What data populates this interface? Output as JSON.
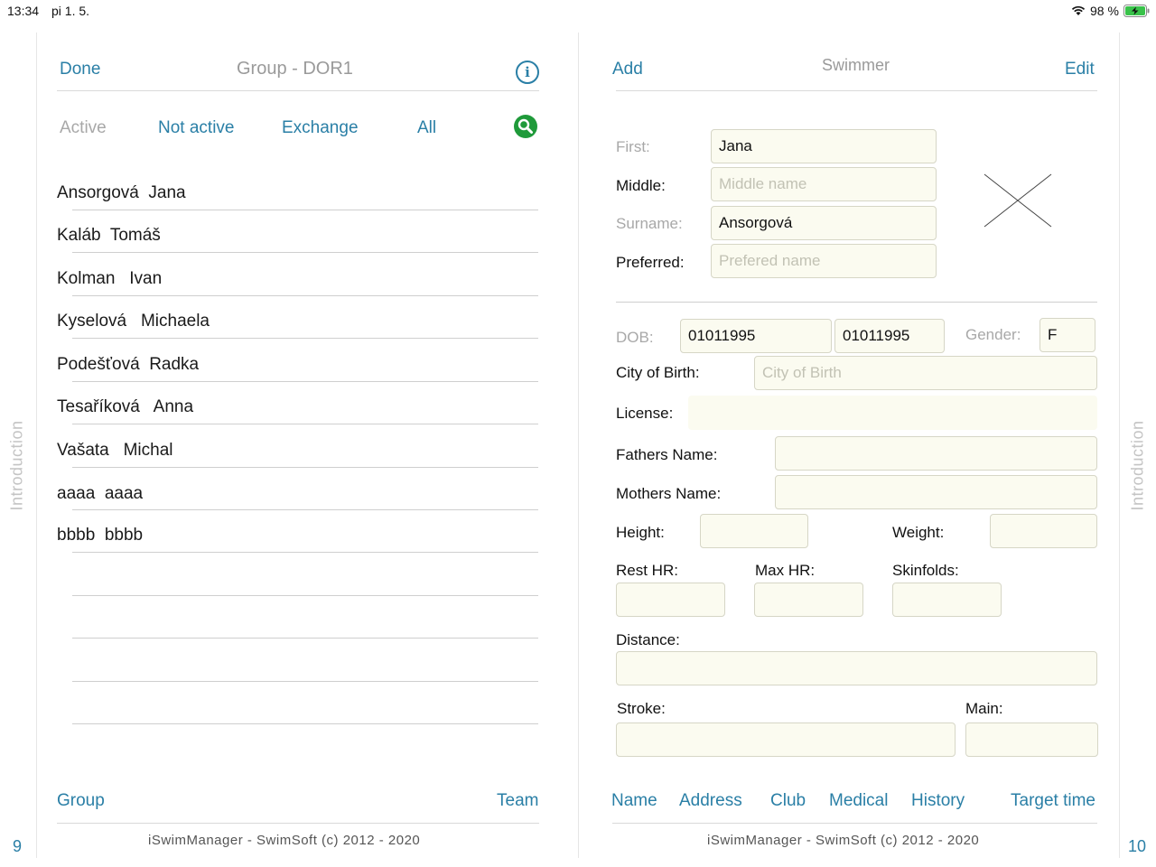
{
  "status_bar": {
    "time": "13:34",
    "date": "pi 1. 5.",
    "battery_percent": "98 %",
    "icons": [
      "wifi-icon",
      "battery-charging-icon"
    ]
  },
  "left_panel": {
    "done": "Done",
    "title": "Group - DOR1",
    "info_icon": "i",
    "tabs": {
      "active": "Active",
      "not_active": "Not active",
      "exchange": "Exchange",
      "all": "All"
    },
    "swimmers": [
      {
        "surname": "Ansorgová",
        "first": "Jana"
      },
      {
        "surname": "Kaláb",
        "first": "Tomáš"
      },
      {
        "surname": "Kolman",
        "first": "Ivan"
      },
      {
        "surname": "Kyselová",
        "first": "Michaela"
      },
      {
        "surname": "Podešťová",
        "first": "Radka"
      },
      {
        "surname": "Tesaříková",
        "first": "Anna"
      },
      {
        "surname": "Vašata",
        "first": "Michal"
      },
      {
        "surname": "aaaa",
        "first": "aaaa"
      },
      {
        "surname": "bbbb",
        "first": "bbbb"
      }
    ],
    "bottom_nav": {
      "group": "Group",
      "team": "Team"
    },
    "footer": "iSwimManager - SwimSoft (c) 2012 - 2020",
    "page_number": "9",
    "side_label": "Introduction"
  },
  "right_panel": {
    "add": "Add",
    "title": "Swimmer",
    "edit": "Edit",
    "labels": {
      "first": "First:",
      "middle": "Middle:",
      "surname": "Surname:",
      "preferred": "Preferred:",
      "dob": "DOB:",
      "gender": "Gender:",
      "city_of_birth": "City of Birth:",
      "license": "License:",
      "fathers_name": "Fathers Name:",
      "mothers_name": "Mothers Name:",
      "height": "Height:",
      "weight": "Weight:",
      "rest_hr": "Rest HR:",
      "max_hr": "Max HR:",
      "skinfolds": "Skinfolds:",
      "distance": "Distance:",
      "stroke": "Stroke:",
      "main": "Main:"
    },
    "values": {
      "first": "Jana",
      "surname": "Ansorgová",
      "dob_1": "01011995",
      "dob_2": "01011995",
      "gender": "F"
    },
    "placeholders": {
      "middle": "Middle name",
      "preferred": "Prefered name",
      "city_of_birth": "City of Birth"
    },
    "bottom_nav": {
      "name": "Name",
      "address": "Address",
      "club": "Club",
      "medical": "Medical",
      "history": "History",
      "target_time": "Target time"
    },
    "footer": "iSwimManager - SwimSoft (c) 2012 - 2020",
    "page_number": "10",
    "side_label": "Introduction"
  }
}
